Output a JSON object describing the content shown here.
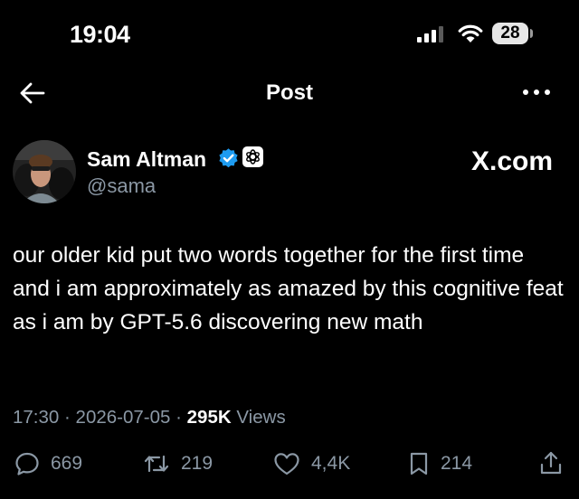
{
  "status_bar": {
    "time": "19:04",
    "battery": "28"
  },
  "nav": {
    "title": "Post"
  },
  "author": {
    "name": "Sam Altman",
    "handle": "@sama"
  },
  "source_label": "X.com",
  "tweet": {
    "text": "our older kid put two words together for the first time and i am approximately as amazed by this cognitive feat as i am by GPT-5.6 discovering new math"
  },
  "meta": {
    "time": "17:30",
    "separator": "·",
    "date": "2026-07-05",
    "views_count": "295K",
    "views_label": "Views"
  },
  "actions": {
    "replies": "669",
    "reposts": "219",
    "likes": "4,4K",
    "bookmarks": "214"
  },
  "colors": {
    "background": "#000000",
    "text": "#ffffff",
    "secondary": "#8b98a5",
    "verified": "#1d9bf0"
  }
}
